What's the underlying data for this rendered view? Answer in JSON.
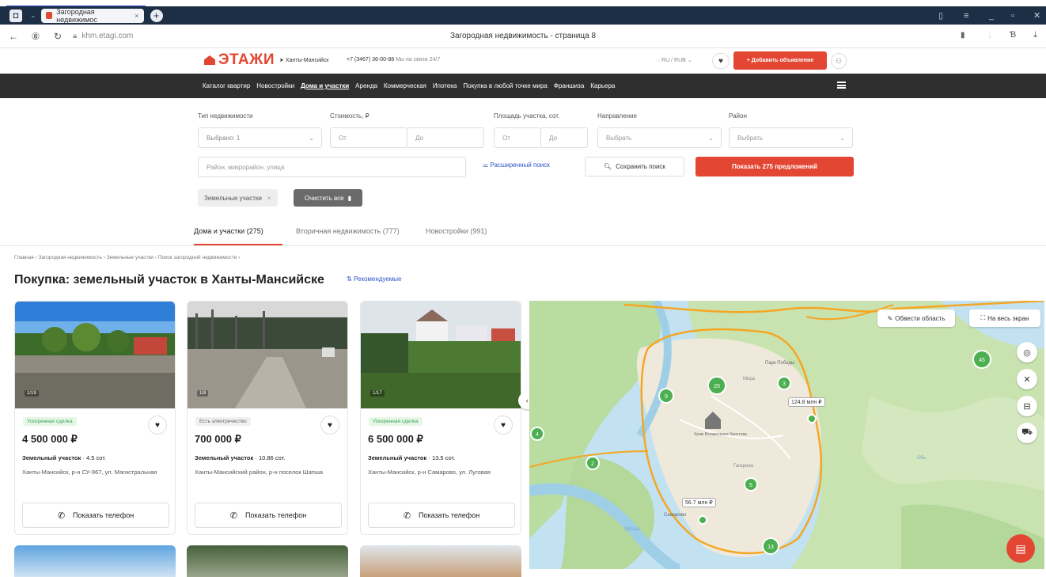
{
  "browser": {
    "tab_title": "Загородная недвижимос",
    "url": "khm.etagi.com",
    "page_title": "Загородная недвижимость - страница 8"
  },
  "header": {
    "logo": "ЭТАЖИ",
    "city": "Ханты-Мансийск",
    "phone": "+7 (3467) 36-00-88",
    "phone_note": "Мы на связи 24/7",
    "currency": "RU / RUB",
    "add_ad": "+ Добавить объявление"
  },
  "nav": {
    "items": [
      "Каталог квартир",
      "Новостройки",
      "Дома и участки",
      "Аренда",
      "Коммерческая",
      "Ипотека",
      "Покупка в любой точке мира",
      "Франшиза",
      "Карьера"
    ],
    "active_index": 2
  },
  "filters": {
    "type_label": "Тип недвижимости",
    "type_value": "Выбрано: 1",
    "price_label": "Стоимость, ₽",
    "price_from": "От",
    "price_to": "До",
    "area_label": "Площадь участка, сот.",
    "area_from": "От",
    "area_to": "До",
    "direction_label": "Направление",
    "direction_value": "Выбрать",
    "district_label": "Район",
    "district_value": "Выбрать",
    "search_placeholder": "Район, микрорайон, улица",
    "advanced": "Расширенный поиск",
    "save": "Сохранить поиск",
    "show": "Показать 275 предложений",
    "chip": "Земельные участки",
    "clear_all": "Очистить все"
  },
  "category_tabs": [
    "Дома и участки (275)",
    "Вторичная недвижимость (777)",
    "Новостройки (991)"
  ],
  "breadcrumbs": "Главная  ›  Загородная недвижимость  ›  Земельные участки  ›  Поиск загородной недвижимости  ›",
  "heading": "Покупка: земельный участок в Ханты-Мансийске",
  "sort": "Рекомендуемые",
  "listings": [
    {
      "count": "1/19",
      "badge": "Ускоренная сделка",
      "price": "4 500 000 ₽",
      "type": "Земельный участок",
      "area": "4.5 сот.",
      "address": "Ханты-Мансийск, р-н СУ-967, ул. Магистральная",
      "call": "Показать телефон"
    },
    {
      "count": "1/8",
      "badge": "Есть электричество",
      "price": "700 000 ₽",
      "type": "Земельный участок",
      "area": "10.86 сот.",
      "address": "Ханты-Мансийский район, р-н поселок Шапша",
      "call": "Показать телефон"
    },
    {
      "count": "1/17",
      "badge": "Ускоренная сделка",
      "price": "6 500 000 ₽",
      "type": "Земельный участок",
      "area": "13.5 сот.",
      "address": "Ханты-Мансийск, р-н Самарово, ул. Луговая",
      "call": "Показать телефон"
    }
  ],
  "map": {
    "area_btn": "Обвести область",
    "fullscreen_btn": "На весь экран",
    "price_tag_1": "124.8 млн ₽",
    "price_tag_2": "56.7 млн ₽",
    "clusters": [
      "45",
      "20",
      "9",
      "3",
      "4",
      "2",
      "5",
      "13"
    ],
    "labels": [
      "Мира",
      "Парк Победы",
      "Храм Воскресения Христова",
      "Гагарина",
      "Самарово",
      "Иртыш",
      "Обь"
    ]
  },
  "colors": {
    "accent": "#e34733",
    "nav_bg": "#2f2f2f",
    "link": "#2b55c7",
    "cluster": "#4caf50"
  }
}
